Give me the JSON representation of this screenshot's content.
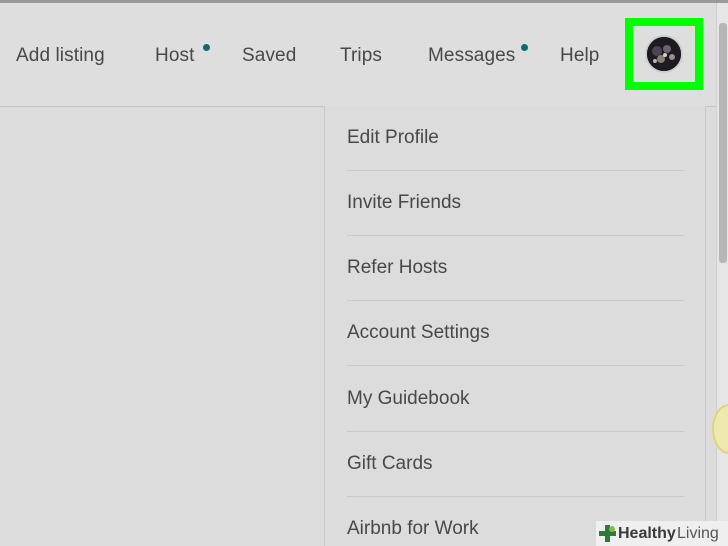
{
  "header": {
    "nav": [
      {
        "label": "Add listing",
        "has_dot": false
      },
      {
        "label": "Host",
        "has_dot": true
      },
      {
        "label": "Saved",
        "has_dot": false
      },
      {
        "label": "Trips",
        "has_dot": false
      },
      {
        "label": "Messages",
        "has_dot": true
      },
      {
        "label": "Help",
        "has_dot": false
      }
    ],
    "avatar_icon": "user-avatar",
    "highlight_color": "#00ff00",
    "notification_dot_color": "#0b6b70"
  },
  "profile_menu": {
    "items": [
      "Edit Profile",
      "Invite Friends",
      "Refer Hosts",
      "Account Settings",
      "My Guidebook",
      "Gift Cards",
      "Airbnb for Work"
    ]
  },
  "watermark": {
    "bold": "Healthy",
    "light": "Living",
    "icon": "plus-leaf-icon"
  }
}
